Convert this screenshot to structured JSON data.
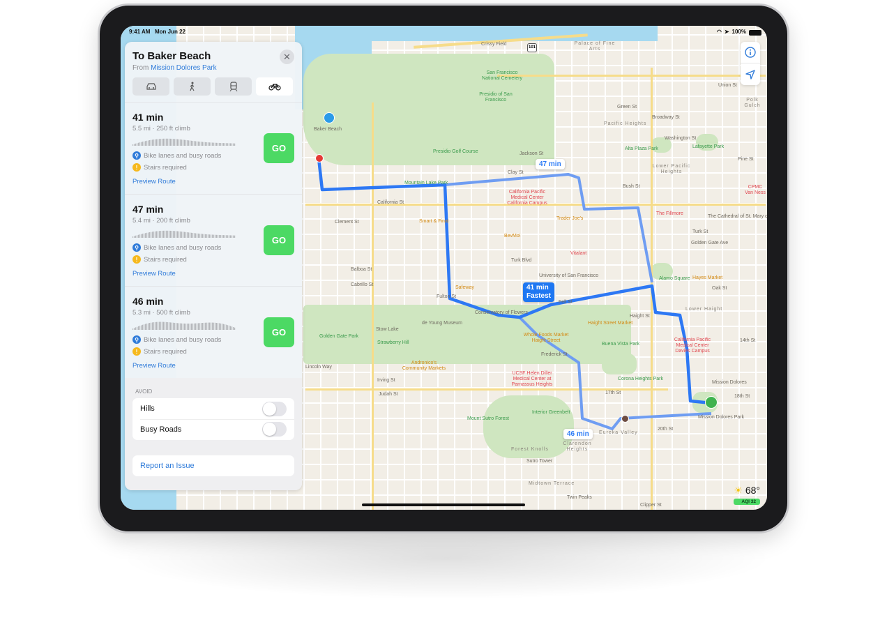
{
  "status_bar": {
    "time": "9:41 AM",
    "date": "Mon Jun 22",
    "battery": "100%"
  },
  "directions": {
    "title": "To Baker Beach",
    "from_label": "From",
    "from_place": "Mission Dolores Park",
    "modes": [
      {
        "icon": "car-icon",
        "active": false
      },
      {
        "icon": "walk-icon",
        "active": false
      },
      {
        "icon": "transit-icon",
        "active": false
      },
      {
        "icon": "bike-icon",
        "active": true
      }
    ],
    "routes": [
      {
        "time": "41 min",
        "details": "5.5 mi · 250 ft climb",
        "feature1": "Bike lanes and busy roads",
        "feature2": "Stairs required",
        "preview": "Preview Route",
        "go": "GO"
      },
      {
        "time": "47 min",
        "details": "5.4 mi · 200 ft climb",
        "feature1": "Bike lanes and busy roads",
        "feature2": "Stairs required",
        "preview": "Preview Route",
        "go": "GO"
      },
      {
        "time": "46 min",
        "details": "5.3 mi · 500 ft climb",
        "feature1": "Bike lanes and busy roads",
        "feature2": "Stairs required",
        "preview": "Preview Route",
        "go": "GO"
      }
    ],
    "avoid": {
      "header": "AVOID",
      "options": [
        {
          "label": "Hills",
          "on": false
        },
        {
          "label": "Busy Roads",
          "on": false
        }
      ]
    },
    "report": "Report an Issue"
  },
  "map": {
    "route_labels": {
      "r47": "47 min",
      "r41_time": "41 min",
      "r41_tag": "Fastest",
      "r46": "46 min"
    },
    "labels": [
      "Crissy Field",
      "Palace of Fine Arts",
      "San Francisco National Cemetery",
      "Presidio of San Francisco",
      "Baker Beach",
      "Presidio Golf Course",
      "Mountain Lake Park",
      "California St",
      "Clement St",
      "Balboa St",
      "Cabrillo St",
      "Fulton St",
      "Golden Gate Park",
      "Stow Lake",
      "Strawberry Hill",
      "de Young Museum",
      "Conservatory of Flowers",
      "Lincoln Way",
      "Irving St",
      "Judah St",
      "Mount Sutro Forest",
      "Interior Greenbelt",
      "UCSF Helen Diller Medical Center at Parnassus Heights",
      "Andronico's Community Markets",
      "Forest Knolls",
      "Sutro Tower",
      "Midtown Terrace",
      "Twin Peaks",
      "Clarendon Heights",
      "Eureka Valley",
      "Mission Dolores Park",
      "Mission Dolores",
      "Corona Heights Park",
      "Buena Vista Park",
      "Haight Street Market",
      "Whole Foods Market Haight Street",
      "Lower Haight",
      "California Pacific Medical Center Davies Campus",
      "Alamo Square",
      "Hayes Market",
      "The Fillmore",
      "The Cathedral of St. Mary of the Assumption",
      "CPMC Van Ness",
      "Lafayette Park",
      "Alta Plaza Park",
      "Pacific Heights",
      "Lower Pacific Heights",
      "Polk Gulch",
      "University of San Francisco",
      "Vitalant",
      "Trader Joe's",
      "BevMo!",
      "Safeway",
      "Smart & Final",
      "California Pacific Medical Center California Campus",
      "Jackson St",
      "Clay St",
      "Bush St",
      "Turk Blvd",
      "Fell St",
      "Haight St",
      "Frederick St",
      "17th St",
      "20th St",
      "14th St",
      "18th St",
      "Broadway St",
      "Union St",
      "Green St",
      "Washington St",
      "Pine St",
      "Oak St",
      "Turk St",
      "Golden Gate Ave",
      "Clipper St"
    ],
    "highway_shield": "101"
  },
  "weather": {
    "temp": "68°",
    "aqi": "AQI 32"
  },
  "colors": {
    "route": "#5b8ff0",
    "route_selected": "#2d78f4",
    "go": "#4cd964",
    "link": "#2f7bd9",
    "park": "#cfe6c0",
    "water": "#a6d9f0"
  }
}
